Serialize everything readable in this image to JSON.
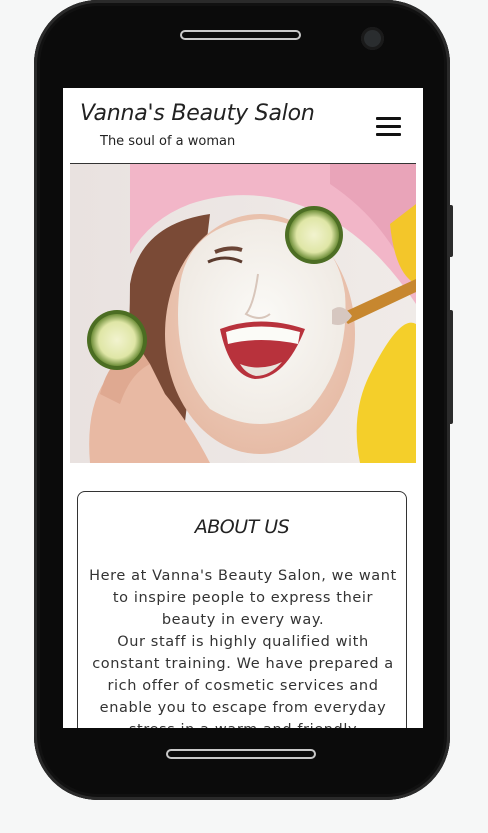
{
  "site": {
    "title": "Vanna's Beauty Salon",
    "tagline": "The soul of a woman"
  },
  "nav": {
    "menu_icon": "hamburger-menu-icon"
  },
  "hero": {
    "image_alt": ""
  },
  "about": {
    "heading": "ABOUT US",
    "paragraph_1": "Here at Vanna's Beauty Salon, we want to inspire people to express their beauty in every way.",
    "paragraph_2": "Our staff is highly qualified with constant training. We have prepared a rich offer of cosmetic services and enable you to escape from everyday stress in a warm and friendly"
  },
  "colors": {
    "phone_body": "#0b0b0b",
    "page_background": "#f6f7f7",
    "screen_background": "#ffffff",
    "towel": "#f2b6c8",
    "text": "#333333"
  }
}
